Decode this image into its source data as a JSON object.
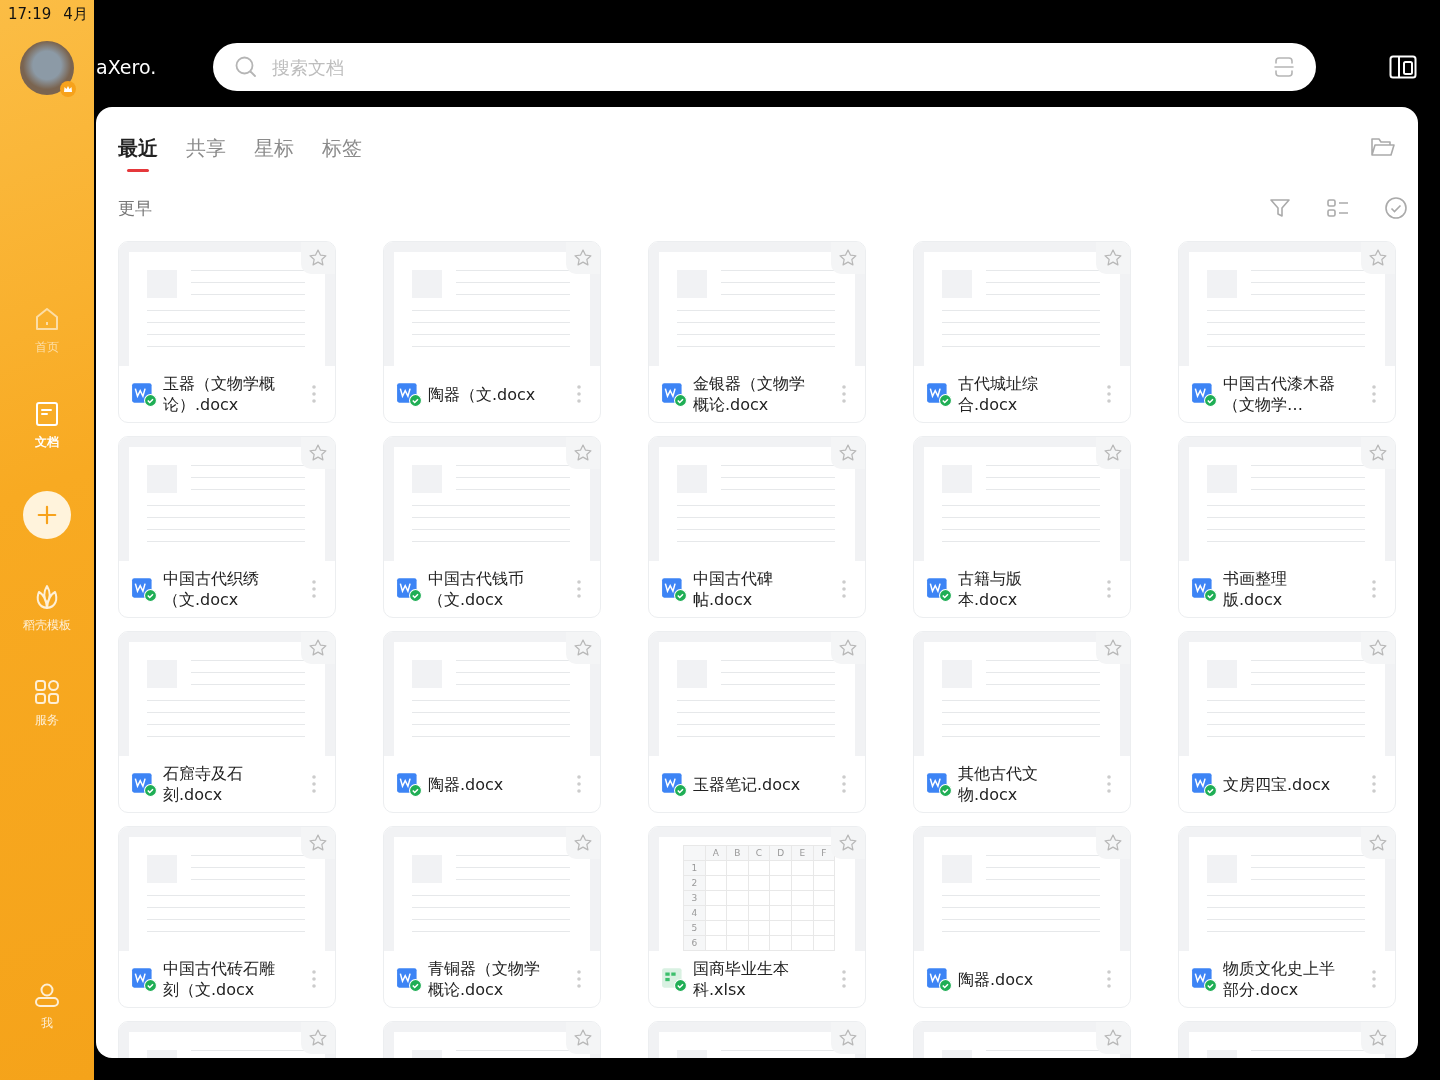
{
  "status_bar": {
    "time": "17:19",
    "date": "4月"
  },
  "user": {
    "name": "aXero."
  },
  "sidebar": {
    "items": [
      {
        "kind": "home",
        "label": "首页",
        "selected": false,
        "faded": true
      },
      {
        "kind": "docs",
        "label": "文档",
        "selected": true,
        "faded": false
      },
      {
        "kind": "add",
        "selected": false,
        "faded": false
      },
      {
        "kind": "templates",
        "label": "稻壳模板",
        "selected": false,
        "faded": false
      },
      {
        "kind": "services",
        "label": "服务",
        "selected": false,
        "faded": false
      },
      {
        "kind": "me",
        "label": "我",
        "selected": false,
        "faded": false
      }
    ]
  },
  "search": {
    "placeholder": "搜索文档"
  },
  "tabs": [
    {
      "label": "最近",
      "selected": true
    },
    {
      "label": "共享",
      "selected": false
    },
    {
      "label": "星标",
      "selected": false
    },
    {
      "label": "标签",
      "selected": false
    }
  ],
  "section": {
    "title": "更早"
  },
  "files": [
    {
      "kind": "doc",
      "name": "玉器（文物学概论）.docx"
    },
    {
      "kind": "doc",
      "name": "陶器（文.docx"
    },
    {
      "kind": "doc",
      "name": "金银器（文物学概论.docx"
    },
    {
      "kind": "doc",
      "name": "古代城址综合.docx"
    },
    {
      "kind": "doc",
      "name": "中国古代漆木器（文物学…"
    },
    {
      "kind": "doc",
      "name": "中国古代织绣（文.docx"
    },
    {
      "kind": "doc",
      "name": "中国古代钱币（文.docx"
    },
    {
      "kind": "doc",
      "name": "中国古代碑帖.docx"
    },
    {
      "kind": "doc",
      "name": "古籍与版本.docx"
    },
    {
      "kind": "doc",
      "name": "书画整理版.docx"
    },
    {
      "kind": "doc",
      "name": "石窟寺及石刻.docx"
    },
    {
      "kind": "doc",
      "name": "陶器.docx"
    },
    {
      "kind": "doc",
      "name": "玉器笔记.docx"
    },
    {
      "kind": "doc",
      "name": "其他古代文物.docx"
    },
    {
      "kind": "doc",
      "name": "文房四宝.docx"
    },
    {
      "kind": "doc",
      "name": "中国古代砖石雕刻（文.docx"
    },
    {
      "kind": "doc",
      "name": "青铜器（文物学概论.docx"
    },
    {
      "kind": "sheet",
      "name": "国商毕业生本科.xlsx",
      "sheet": {
        "columns": [
          "A",
          "B",
          "C",
          "D",
          "E",
          "F"
        ],
        "rows": [
          "1",
          "2",
          "3",
          "4",
          "5",
          "6"
        ]
      }
    },
    {
      "kind": "doc",
      "name": "陶器.docx"
    },
    {
      "kind": "doc",
      "name": "物质文化史上半部分.docx"
    },
    {
      "kind": "doc"
    },
    {
      "kind": "doc"
    },
    {
      "kind": "doc"
    },
    {
      "kind": "doc"
    },
    {
      "kind": "doc"
    }
  ]
}
